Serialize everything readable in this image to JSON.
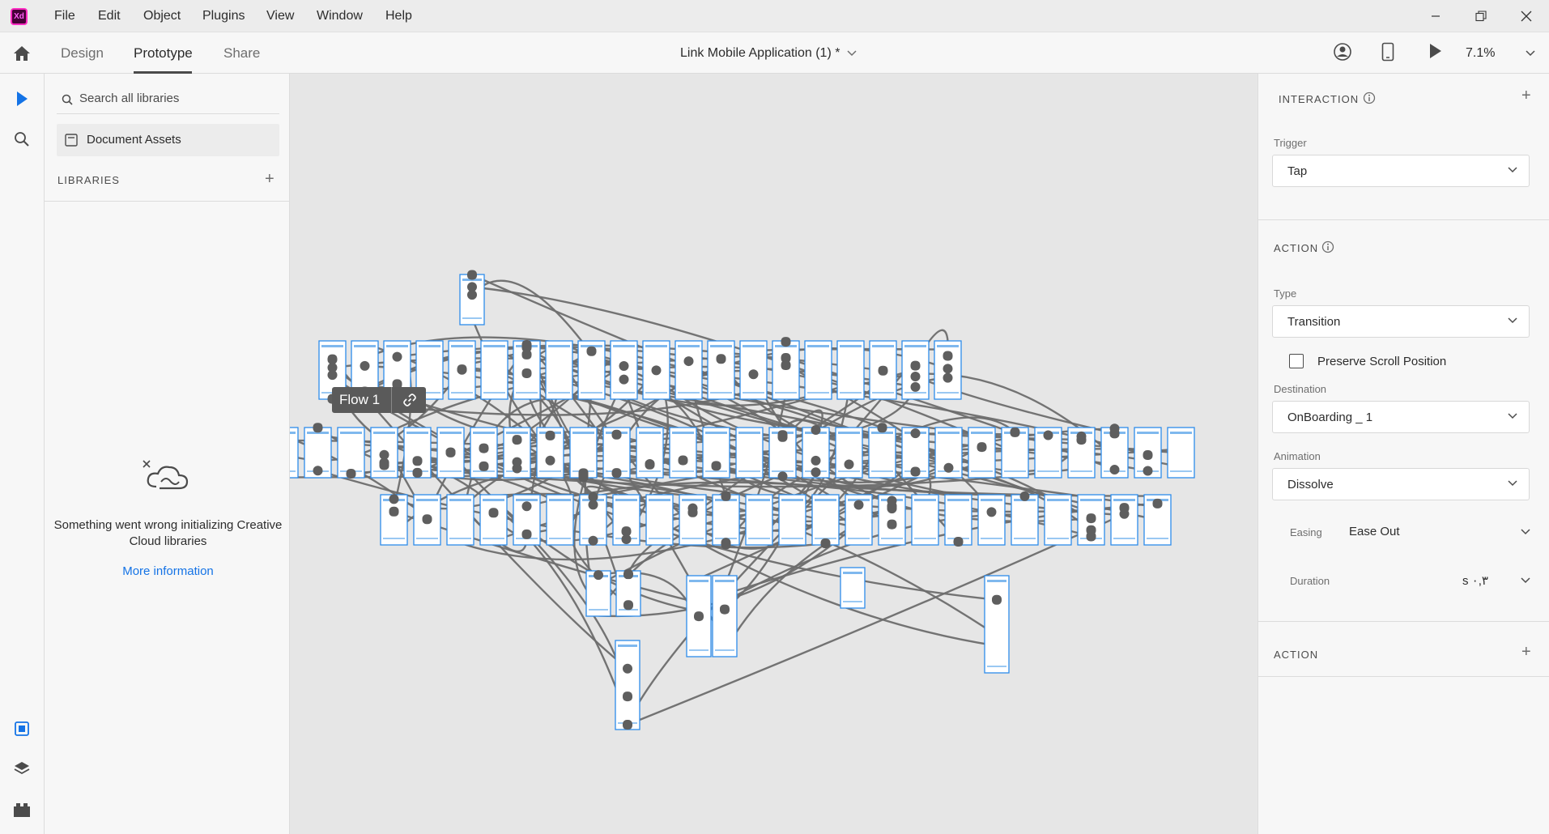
{
  "app": {
    "logo_text": "Xd"
  },
  "menu": [
    "File",
    "Edit",
    "Object",
    "Plugins",
    "View",
    "Window",
    "Help"
  ],
  "modes": {
    "design": "Design",
    "prototype": "Prototype",
    "share": "Share"
  },
  "document": {
    "title": "Link Mobile Application (1) *",
    "zoom": "7.1%"
  },
  "libraries": {
    "search_placeholder": "Search all libraries",
    "document_assets": "Document Assets",
    "section_label": "LIBRARIES",
    "error_message": "Something went wrong initializing Creative Cloud libraries",
    "more_info": "More information"
  },
  "canvas": {
    "flow_label": "Flow 1"
  },
  "interaction": {
    "header": "INTERACTION",
    "trigger_label": "Trigger",
    "trigger_value": "Tap",
    "action_header": "ACTION",
    "type_label": "Type",
    "type_value": "Transition",
    "preserve_scroll": "Preserve Scroll Position",
    "preserve_scroll_checked": false,
    "destination_label": "Destination",
    "destination_value": "OnBoarding _ 1",
    "animation_label": "Animation",
    "animation_value": "Dissolve",
    "easing_label": "Easing",
    "easing_value": "Ease Out",
    "duration_label": "Duration",
    "duration_value": "s ۰,۳",
    "action2_header": "ACTION"
  },
  "colors": {
    "accent": "#1473e6",
    "wire": "#6d6d6d",
    "artboard_border": "#2d8ceb",
    "xd_brand": "#470137"
  }
}
